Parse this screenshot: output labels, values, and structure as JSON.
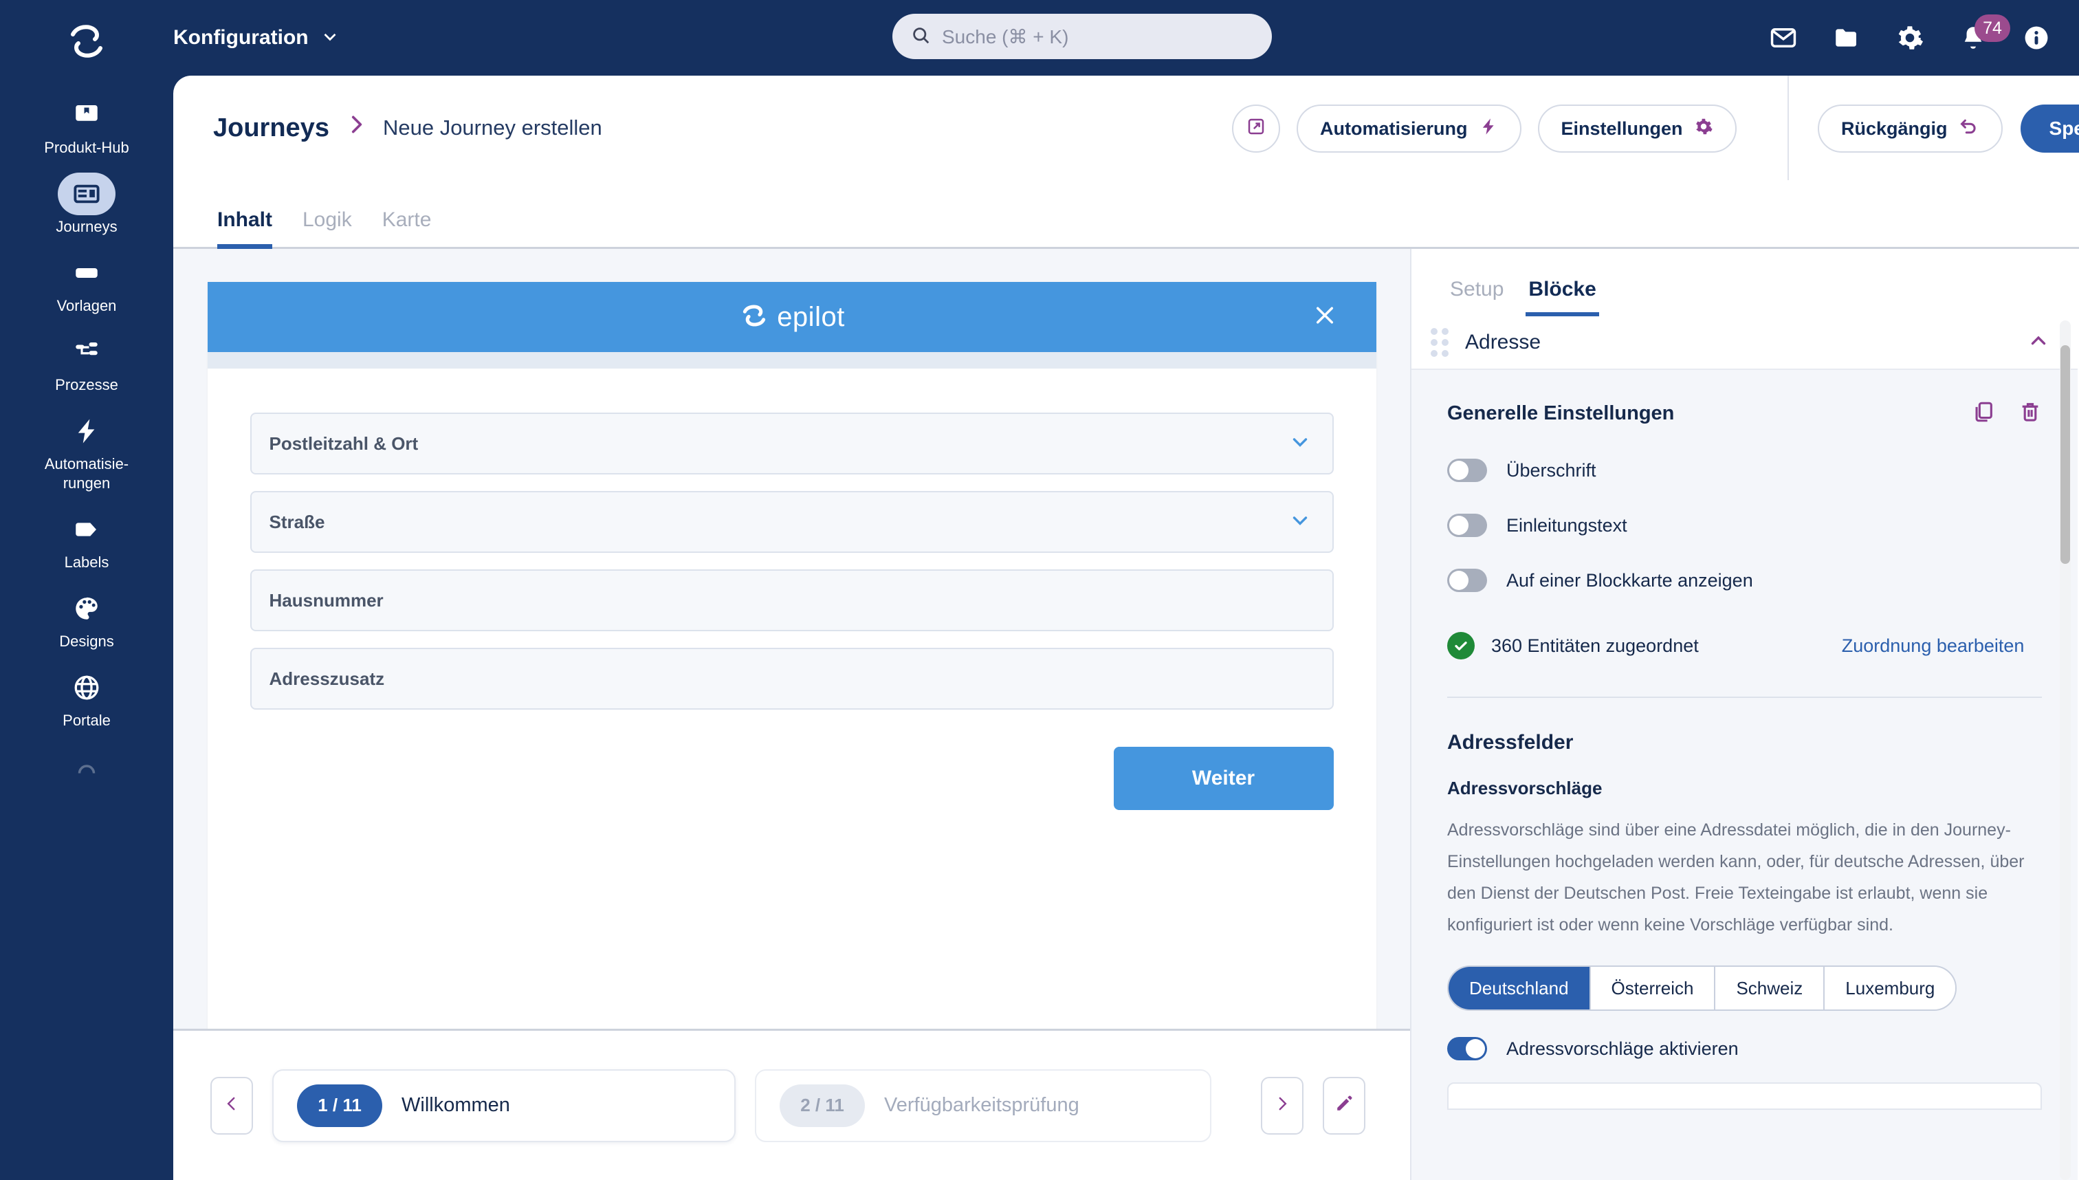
{
  "rail": {
    "logo_icon": "epilot-mark-icon",
    "items": [
      {
        "label": "Produkt-Hub",
        "icon": "product-hub-icon",
        "active": false
      },
      {
        "label": "Journeys",
        "icon": "journeys-icon",
        "active": true
      },
      {
        "label": "Vorlagen",
        "icon": "templates-icon",
        "active": false
      },
      {
        "label": "Prozesse",
        "icon": "processes-icon",
        "active": false
      },
      {
        "label": "Automatisie-\nrungen",
        "icon": "automation-bolt-icon",
        "active": false
      },
      {
        "label": "Labels",
        "icon": "label-tag-icon",
        "active": false
      },
      {
        "label": "Designs",
        "icon": "palette-icon",
        "active": false
      },
      {
        "label": "Portale",
        "icon": "globe-icon",
        "active": false
      }
    ]
  },
  "topbar": {
    "config_label": "Konfiguration",
    "caret_icon": "chevron-down-icon",
    "search": {
      "placeholder": "Suche (⌘ + K)",
      "icon": "search-icon"
    },
    "icons": [
      {
        "name": "mail-icon"
      },
      {
        "name": "folder-icon"
      },
      {
        "name": "gear-icon"
      },
      {
        "name": "bell-icon"
      },
      {
        "name": "info-icon"
      }
    ],
    "notification_count": "74",
    "badge_color": "#9B4B8E"
  },
  "page_header": {
    "crumb_root": "Journeys",
    "crumb_chevron": "›",
    "crumb_leaf": "Neue Journey erstellen",
    "open_external_icon": "open-external-icon",
    "automation_label": "Automatisierung",
    "automation_icon": "bolt-icon",
    "settings_label": "Einstellungen",
    "settings_icon": "gear-icon",
    "undo_label": "Rückgängig",
    "undo_icon": "undo-arrow-icon",
    "save_label": "Speichern",
    "save_caret_icon": "chevron-down-icon",
    "accent_color": "#8B3E91",
    "primary_color": "#2B5FAD"
  },
  "tabs": [
    {
      "label": "Inhalt",
      "active": true
    },
    {
      "label": "Logik",
      "active": false
    },
    {
      "label": "Karte",
      "active": false
    }
  ],
  "preview": {
    "brand": "epilot",
    "brand_icon": "epilot-mark-icon",
    "close_icon": "close-icon",
    "header_color": "#4596DE",
    "fields": [
      {
        "label": "Postleitzahl & Ort",
        "type": "select",
        "icon": "chevron-down-icon"
      },
      {
        "label": "Straße",
        "type": "select",
        "icon": "chevron-down-icon"
      },
      {
        "label": "Hausnummer",
        "type": "text",
        "icon": ""
      },
      {
        "label": "Adresszusatz",
        "type": "text",
        "icon": ""
      }
    ],
    "submit_label": "Weiter"
  },
  "stepbar": {
    "prev_icon": "chevron-left-icon",
    "next_icon": "chevron-right-icon",
    "edit_icon": "pencil-icon",
    "steps": [
      {
        "counter": "1 / 11",
        "name": "Willkommen",
        "state": "current"
      },
      {
        "counter": "2 / 11",
        "name": "Verfügbarkeitsprüfung",
        "state": "next"
      }
    ]
  },
  "panel": {
    "tabs": [
      {
        "label": "Setup",
        "active": false
      },
      {
        "label": "Blöcke",
        "active": true
      }
    ],
    "block_title": "Adresse",
    "drag_handle_icon": "drag-dots-icon",
    "collapse_icon": "chevron-up-icon",
    "general_title": "Generelle Einstellungen",
    "duplicate_icon": "copy-icon",
    "delete_icon": "trash-icon",
    "toggles": [
      {
        "label": "Überschrift",
        "on": false
      },
      {
        "label": "Einleitungstext",
        "on": false
      },
      {
        "label": "Auf einer Blockkarte anzeigen",
        "on": false
      }
    ],
    "entities_check_icon": "check-circle-icon",
    "entities_text": "360 Entitäten zugeordnet",
    "entities_link": "Zuordnung bearbeiten",
    "address_fields_title": "Adressfelder",
    "suggestions_title": "Adressvorschläge",
    "suggestions_desc": "Adressvorschläge sind über eine Adressdatei möglich, die in den Journey-Einstellungen hochgeladen werden kann, oder, für deutsche Adressen, über den Dienst der Deutschen Post. Freie Texteingabe ist erlaubt, wenn sie konfiguriert ist oder wenn keine Vorschläge verfügbar sind.",
    "countries": [
      {
        "label": "Deutschland",
        "active": true
      },
      {
        "label": "Österreich",
        "active": false
      },
      {
        "label": "Schweiz",
        "active": false
      },
      {
        "label": "Luxemburg",
        "active": false
      }
    ],
    "activate_toggle": {
      "label": "Adressvorschläge aktivieren",
      "on": true
    }
  }
}
